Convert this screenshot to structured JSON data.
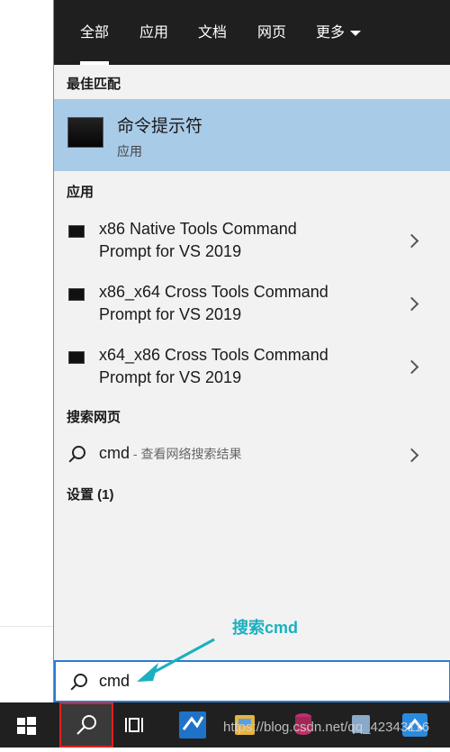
{
  "tabs": [
    {
      "label": "全部"
    },
    {
      "label": "应用"
    },
    {
      "label": "文档"
    },
    {
      "label": "网页"
    },
    {
      "label": "更多"
    }
  ],
  "best_match": {
    "heading": "最佳匹配",
    "title": "命令提示符",
    "subtitle": "应用"
  },
  "apps": {
    "heading": "应用",
    "items": [
      {
        "line1": "x86 Native Tools Command",
        "line2": "Prompt for VS 2019"
      },
      {
        "line1": "x86_x64 Cross Tools Command",
        "line2": "Prompt for VS 2019"
      },
      {
        "line1": "x64_x86 Cross Tools Command",
        "line2": "Prompt for VS 2019"
      }
    ]
  },
  "web": {
    "heading": "搜索网页",
    "query": "cmd",
    "hint": " - 查看网络搜索结果"
  },
  "settings": {
    "heading": "设置 (1)"
  },
  "search": {
    "value": "cmd"
  },
  "annotation": {
    "text": "搜索cmd",
    "color": "#1ab0c0"
  },
  "watermark": {
    "text": "https://blog.csdn.net/qq_42343116"
  },
  "colors": {
    "tabs_bg": "#1f1f1f",
    "selected_bg": "#a8cbe8",
    "panel_bg": "#f2f2f2",
    "search_border": "#2b7cd3",
    "taskbar_bg": "#202020"
  }
}
